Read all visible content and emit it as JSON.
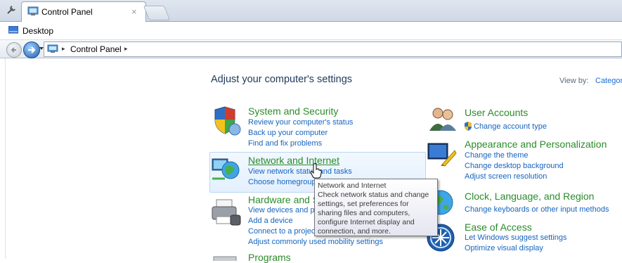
{
  "tab": {
    "title": "Control Panel",
    "close": "×"
  },
  "desktop": {
    "label": "Desktop"
  },
  "address": {
    "separator": "▸",
    "crumb": "Control Panel"
  },
  "heading": "Adjust your computer's settings",
  "view_by": {
    "label": "View by:",
    "value": "Categor"
  },
  "categories": {
    "system": {
      "title": "System and Security",
      "links": [
        "Review your computer's status",
        "Back up your computer",
        "Find and fix problems"
      ]
    },
    "network": {
      "title": "Network and Internet",
      "links": [
        "View network status and tasks",
        "Choose homegroup"
      ]
    },
    "hardware": {
      "title": "Hardware and S",
      "links": [
        "View devices and pr",
        "Add a device",
        "Connect to a projec",
        "Adjust commonly used mobility settings"
      ]
    },
    "programs": {
      "title": "Programs"
    },
    "users": {
      "title": "User Accounts",
      "links": [
        "Change account type"
      ]
    },
    "appearance": {
      "title": "Appearance and Personalization",
      "links": [
        "Change the theme",
        "Change desktop background",
        "Adjust screen resolution"
      ]
    },
    "clock": {
      "title": "Clock, Language, and Region",
      "links": [
        "Change keyboards or other input methods"
      ]
    },
    "ease": {
      "title": "Ease of Access",
      "links": [
        "Let Windows suggest settings",
        "Optimize visual display"
      ]
    }
  },
  "tooltip": {
    "title": "Network and Internet",
    "body": "Check network status and change settings, set preferences for sharing files and computers, configure Internet display and connection, and more."
  },
  "colors": {
    "category_green": "#2a8c2a",
    "link_blue": "#1565c0",
    "heading": "#1e395b"
  }
}
